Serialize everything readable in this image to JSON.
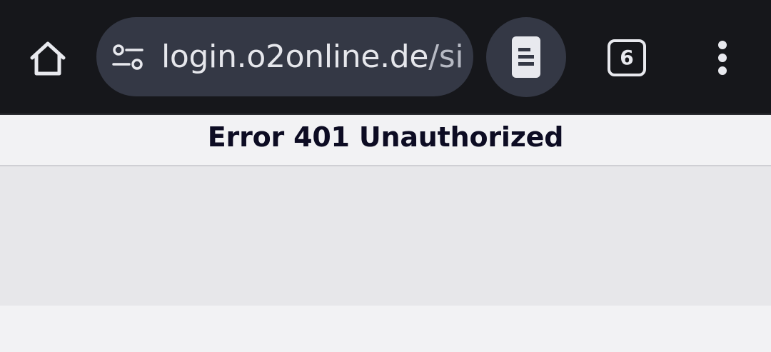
{
  "browser": {
    "home_icon": "home-icon",
    "site_settings_icon": "tune-icon",
    "url_host": "login.o2online.de",
    "url_path": "/sig",
    "reader_icon": "reader-mode-icon",
    "tab_count": "6",
    "menu_icon": "more-vert-icon",
    "colors": {
      "toolbar": "#16171b",
      "omnibox": "#343845",
      "icon": "#e8e9ee"
    }
  },
  "page": {
    "title": "Error 401 Unauthorized"
  }
}
